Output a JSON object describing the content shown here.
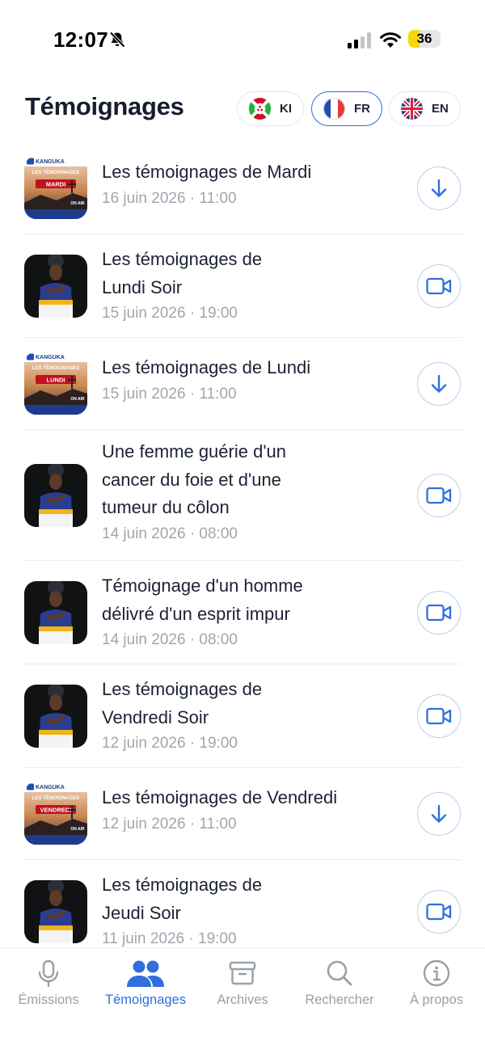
{
  "status_bar": {
    "time": "12:07",
    "battery": "36"
  },
  "header": {
    "title": "Témoignages",
    "languages": [
      {
        "code": "KI",
        "active": false
      },
      {
        "code": "FR",
        "active": true
      },
      {
        "code": "EN",
        "active": false
      }
    ]
  },
  "colors": {
    "accent": "#2f6fde",
    "text": "#1c2235",
    "muted": "#a0a5ae",
    "battery": "#f5d90a"
  },
  "list": {
    "items": [
      {
        "title_lines": [
          "Les témoignages de Mardi"
        ],
        "date": "16 juin 2026 · 11:00",
        "type": "download",
        "thumb": "poster",
        "poster_day": "MARDI"
      },
      {
        "title_lines": [
          "Les témoignages de",
          "Lundi Soir"
        ],
        "date": "15 juin 2026 · 19:00",
        "type": "video",
        "thumb": "preacher"
      },
      {
        "title_lines": [
          "Les témoignages de Lundi"
        ],
        "date": "15 juin 2026 · 11:00",
        "type": "download",
        "thumb": "poster",
        "poster_day": "LUNDI"
      },
      {
        "title_lines": [
          "Une femme guérie d'un",
          "cancer du foie et d'une",
          "tumeur du côlon"
        ],
        "date": "14 juin 2026 · 08:00",
        "type": "video",
        "thumb": "preacher"
      },
      {
        "title_lines": [
          "Témoignage d'un homme",
          "délivré d'un esprit impur"
        ],
        "date": "14 juin 2026 · 08:00",
        "type": "video",
        "thumb": "preacher"
      },
      {
        "title_lines": [
          "Les témoignages de",
          "Vendredi Soir"
        ],
        "date": "12 juin 2026 · 19:00",
        "type": "video",
        "thumb": "preacher"
      },
      {
        "title_lines": [
          "Les témoignages de Vendredi"
        ],
        "date": "12 juin 2026 · 11:00",
        "type": "download",
        "thumb": "poster",
        "poster_day": "VENDREDI"
      },
      {
        "title_lines": [
          "Les témoignages de",
          "Jeudi Soir"
        ],
        "date": "11 juin 2026 · 19:00",
        "type": "video",
        "thumb": "preacher"
      }
    ],
    "poster": {
      "brand": "KANGUKA",
      "heading": "LES TÉMOIGNAGES",
      "on_air": "ON AIR"
    }
  },
  "tab_bar": {
    "tabs": [
      {
        "label": "Émissions",
        "icon": "microphone-icon",
        "active": false
      },
      {
        "label": "Témoignages",
        "icon": "people-icon",
        "active": true
      },
      {
        "label": "Archives",
        "icon": "archive-box-icon",
        "active": false
      },
      {
        "label": "Rechercher",
        "icon": "search-icon",
        "active": false
      },
      {
        "label": "À propos",
        "icon": "info-icon",
        "active": false
      }
    ]
  }
}
